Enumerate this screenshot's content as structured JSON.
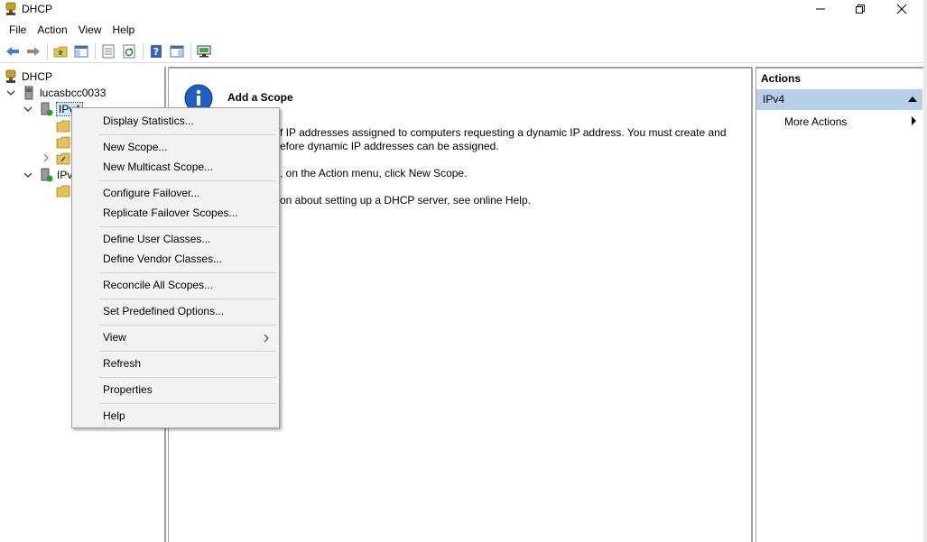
{
  "window": {
    "title": "DHCP"
  },
  "menubar": {
    "items": [
      "File",
      "Action",
      "View",
      "Help"
    ]
  },
  "toolbar": {
    "icons": [
      "back-arrow-icon",
      "forward-arrow-icon",
      "up-folder-icon",
      "show-hide-tree-icon",
      "properties-icon",
      "refresh-icon",
      "help-icon",
      "show-hide-action-pane-icon",
      "server-status-icon"
    ]
  },
  "tree": {
    "root": "DHCP",
    "server": "lucasbcc0033",
    "ipv4": "IPv4",
    "ipv6": "IPv"
  },
  "content": {
    "title": "Add a Scope",
    "line1": "f IP addresses assigned to computers requesting a dynamic IP address. You must create and",
    "line2": "efore dynamic IP addresses can be assigned.",
    "line3": ", on the Action menu, click New Scope.",
    "line4": "on about setting up a DHCP server, see online Help."
  },
  "actions": {
    "header": "Actions",
    "section": "IPv4",
    "more": "More Actions"
  },
  "context_menu": {
    "items": [
      "Display Statistics...",
      "New Scope...",
      "New Multicast Scope...",
      "Configure Failover...",
      "Replicate Failover Scopes...",
      "Define User Classes...",
      "Define Vendor Classes...",
      "Reconcile All Scopes...",
      "Set Predefined Options...",
      "View",
      "Refresh",
      "Properties",
      "Help"
    ]
  },
  "colors": {
    "selection": "#cce8ff",
    "actions_section_bg": "#b7cfe9",
    "menu_bg": "#f2f2f2"
  }
}
